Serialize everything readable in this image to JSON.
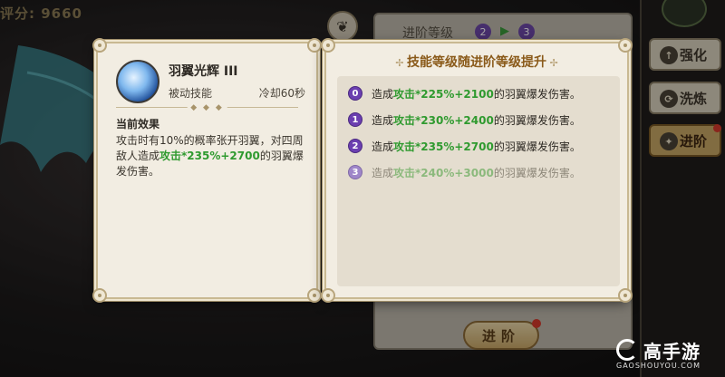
{
  "background": {
    "score_text": "评分: 9660",
    "right_panel_title": "进阶等级",
    "badge_from": "2",
    "badge_to": "3",
    "advance_button": "进阶",
    "side_tabs": [
      "强化",
      "洗炼",
      "进阶"
    ],
    "active_tab": "进阶"
  },
  "skill_card": {
    "name": "羽翼光辉 III",
    "type": "被动技能",
    "cooldown": "冷却60秒",
    "effect_title": "当前效果",
    "effect_prefix": "攻击时有10%的概率张开羽翼，对四周敌人造成",
    "effect_highlight": "攻击*235%+2700",
    "effect_suffix": "的羽翼爆发伤害。"
  },
  "levels_card": {
    "title": "技能等级随进阶等级提升",
    "rows": [
      {
        "level": "0",
        "prefix": "造成",
        "highlight": "攻击*225%+2100",
        "suffix": "的羽翼爆发伤害。",
        "locked": false
      },
      {
        "level": "1",
        "prefix": "造成",
        "highlight": "攻击*230%+2400",
        "suffix": "的羽翼爆发伤害。",
        "locked": false
      },
      {
        "level": "2",
        "prefix": "造成",
        "highlight": "攻击*235%+2700",
        "suffix": "的羽翼爆发伤害。",
        "locked": false
      },
      {
        "level": "3",
        "prefix": "造成",
        "highlight": "攻击*240%+3000",
        "suffix": "的羽翼爆发伤害。",
        "locked": true
      }
    ]
  },
  "watermark": {
    "text": "高手游",
    "sub": "GAOSHOUYOU.COM"
  },
  "colors": {
    "highlight_green": "#2f9a2f",
    "level_badge_purple": "#6b3fb0",
    "title_brown": "#8a5a1a"
  }
}
